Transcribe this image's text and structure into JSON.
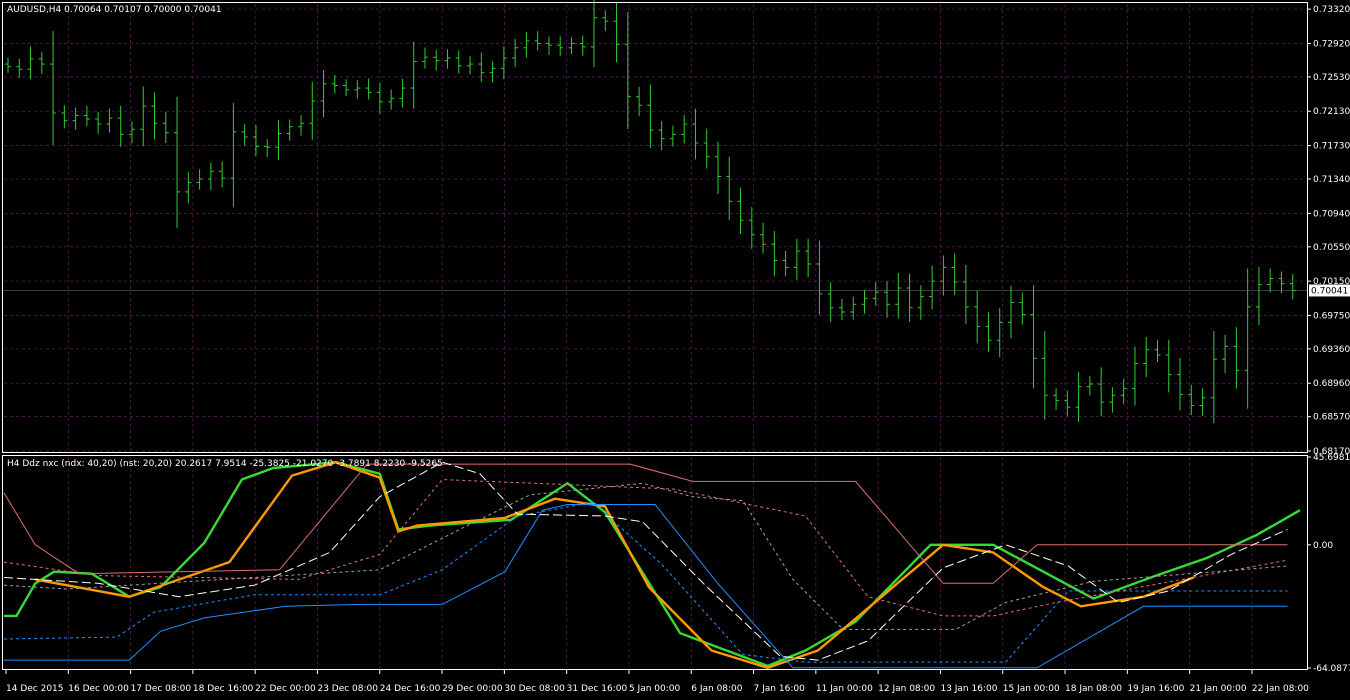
{
  "main_window": {
    "header": "AUDUSD,H4  0.70064 0.70107 0.70000 0.70041",
    "current_price_label": "0.70041"
  },
  "indicator_window": {
    "header": "H4 Ddz nxc (ndx: 40,20) (nst: 20,20) 20.2617 7.9514 -25.3825 -21.0270 -3.7891 8.2230 -9.5265"
  },
  "time_axis_labels": [
    "14 Dec 2015",
    "16 Dec 00:00",
    "17 Dec 08:00",
    "18 Dec 16:00",
    "22 Dec 00:00",
    "23 Dec 08:00",
    "24 Dec 16:00",
    "29 Dec 00:00",
    "30 Dec 08:00",
    "31 Dec 16:00",
    "5 Jan 00:00",
    "6 Jan 08:00",
    "7 Jan 16:00",
    "11 Jan 00:00",
    "12 Jan 08:00",
    "13 Jan 16:00",
    "15 Jan 00:00",
    "18 Jan 08:00",
    "19 Jan 16:00",
    "21 Jan 00:00",
    "22 Jan 08:00"
  ],
  "colors": {
    "background": "#000000",
    "bars": "#33cc33",
    "grid": "#5a1a5a",
    "axis": "#ffffff",
    "green_line": "#33dd33",
    "orange_line": "#ff9900",
    "blue_line": "#1e90ff",
    "salmon_line": "#e07070",
    "white_dash": "#ffffff",
    "gray_dash": "#a0a0a0"
  },
  "chart_data": [
    {
      "type": "ohlc",
      "symbol": "AUDUSD",
      "timeframe": "H4",
      "y_ticks": [
        "0.73320",
        "0.72920",
        "0.72530",
        "0.72130",
        "0.71730",
        "0.71340",
        "0.70940",
        "0.70550",
        "0.70150",
        "0.69750",
        "0.69360",
        "0.68960",
        "0.68570",
        "0.68170"
      ],
      "ylim": [
        0.6817,
        0.7338
      ],
      "current_price": 0.70041,
      "close_path": [
        0.7265,
        0.7262,
        0.7274,
        0.7268,
        0.7211,
        0.7202,
        0.7208,
        0.7204,
        0.7198,
        0.7205,
        0.7186,
        0.7192,
        0.7219,
        0.7199,
        0.7188,
        0.7119,
        0.713,
        0.7134,
        0.7143,
        0.7135,
        0.7189,
        0.7183,
        0.7172,
        0.7171,
        0.7187,
        0.7195,
        0.7199,
        0.7225,
        0.7245,
        0.7243,
        0.7238,
        0.724,
        0.7235,
        0.7224,
        0.7228,
        0.724,
        0.7271,
        0.7276,
        0.7272,
        0.7275,
        0.7266,
        0.7268,
        0.7258,
        0.7263,
        0.7275,
        0.7287,
        0.7295,
        0.7292,
        0.729,
        0.7287,
        0.7292,
        0.7288,
        0.7322,
        0.7318,
        0.7291,
        0.723,
        0.722,
        0.7191,
        0.7181,
        0.7186,
        0.7198,
        0.7176,
        0.716,
        0.7137,
        0.7108,
        0.7086,
        0.7069,
        0.7058,
        0.7039,
        0.7031,
        0.705,
        0.7035,
        0.7,
        0.6984,
        0.6979,
        0.6988,
        0.6995,
        0.7002,
        0.6988,
        0.7007,
        0.6984,
        0.6997,
        0.7015,
        0.7031,
        0.7014,
        0.6985,
        0.6962,
        0.6946,
        0.6967,
        0.699,
        0.6976,
        0.6925,
        0.6882,
        0.6876,
        0.6868,
        0.6892,
        0.6895,
        0.6874,
        0.6882,
        0.689,
        0.6919,
        0.6935,
        0.6929,
        0.6906,
        0.6883,
        0.687,
        0.6879,
        0.6924,
        0.6939,
        0.6911,
        0.6985,
        0.7011,
        0.7018,
        0.7012,
        0.7004
      ]
    },
    {
      "type": "line",
      "indicator": "Ddz nxc",
      "y_ticks": [
        "45.6981",
        "0.00",
        "-64.0877"
      ],
      "ylim": [
        -64.0877,
        45.6981
      ],
      "series": [
        {
          "color": "#33dd33",
          "style": "solid",
          "values": [
            [
              0,
              -37
            ],
            [
              2,
              -37
            ],
            [
              5,
              -20
            ],
            [
              8,
              -14
            ],
            [
              14,
              -15
            ],
            [
              20,
              -27
            ],
            [
              25,
              -22
            ],
            [
              32,
              1
            ],
            [
              38,
              34
            ],
            [
              43,
              40
            ],
            [
              53,
              43
            ],
            [
              60,
              37
            ],
            [
              63,
              8
            ],
            [
              68,
              10
            ],
            [
              81,
              13
            ],
            [
              90,
              32
            ],
            [
              96,
              17
            ],
            [
              108,
              -46
            ],
            [
              122,
              -63
            ],
            [
              128,
              -55
            ],
            [
              136,
              -40
            ],
            [
              148,
              0
            ],
            [
              158,
              0
            ],
            [
              174,
              -28
            ],
            [
              184,
              -16
            ],
            [
              192,
              -7
            ],
            [
              200,
              5
            ],
            [
              207,
              18
            ]
          ]
        },
        {
          "color": "#ff9900",
          "style": "solid",
          "values": [
            [
              5,
              -18
            ],
            [
              20,
              -27
            ],
            [
              36,
              -9
            ],
            [
              46,
              36
            ],
            [
              53,
              43
            ],
            [
              60,
              35
            ],
            [
              63,
              7
            ],
            [
              66,
              10
            ],
            [
              80,
              14
            ],
            [
              88,
              24
            ],
            [
              96,
              20
            ],
            [
              103,
              -22
            ],
            [
              113,
              -55
            ],
            [
              122,
              -64
            ],
            [
              130,
              -55
            ],
            [
              150,
              0
            ],
            [
              158,
              -4
            ],
            [
              166,
              -22
            ],
            [
              172,
              -32
            ],
            [
              182,
              -27
            ],
            [
              190,
              -17
            ]
          ]
        },
        {
          "color": "#1e90ff",
          "style": "solid",
          "values": [
            [
              0,
              -60
            ],
            [
              20,
              -60
            ],
            [
              25,
              -45
            ],
            [
              32,
              -38
            ],
            [
              45,
              -32
            ],
            [
              57,
              -31
            ],
            [
              70,
              -31
            ],
            [
              80,
              -14
            ],
            [
              86,
              18
            ],
            [
              90,
              21
            ],
            [
              104,
              21
            ],
            [
              114,
              -20
            ],
            [
              126,
              -64
            ],
            [
              165,
              -64
            ],
            [
              182,
              -32
            ],
            [
              205,
              -32
            ]
          ]
        },
        {
          "color": "#1e90ff",
          "style": "dashed",
          "values": [
            [
              0,
              -49
            ],
            [
              18,
              -48
            ],
            [
              24,
              -35
            ],
            [
              40,
              -26
            ],
            [
              60,
              -26
            ],
            [
              70,
              -13
            ],
            [
              82,
              15
            ],
            [
              94,
              22
            ],
            [
              105,
              -10
            ],
            [
              118,
              -57
            ],
            [
              128,
              -61
            ],
            [
              160,
              -61
            ],
            [
              170,
              -24
            ],
            [
              205,
              -24
            ]
          ]
        },
        {
          "color": "#e07070",
          "style": "solid",
          "values": [
            [
              0,
              27
            ],
            [
              5,
              0
            ],
            [
              12,
              -15
            ],
            [
              44,
              -13
            ],
            [
              58,
              42
            ],
            [
              100,
              42
            ],
            [
              110,
              33
            ],
            [
              136,
              33
            ],
            [
              150,
              -20
            ],
            [
              158,
              -20
            ],
            [
              165,
              0
            ],
            [
              205,
              0
            ]
          ]
        },
        {
          "color": "#e07070",
          "style": "dashed",
          "values": [
            [
              0,
              -9
            ],
            [
              15,
              -16
            ],
            [
              47,
              -18
            ],
            [
              60,
              -5
            ],
            [
              70,
              34
            ],
            [
              107,
              29
            ],
            [
              128,
              15
            ],
            [
              138,
              -27
            ],
            [
              150,
              -37
            ],
            [
              158,
              -37
            ],
            [
              168,
              -30
            ],
            [
              205,
              -8
            ]
          ]
        },
        {
          "color": "#a0a0a0",
          "style": "dashed",
          "values": [
            [
              0,
              -21
            ],
            [
              10,
              -23
            ],
            [
              60,
              -13
            ],
            [
              74,
              10
            ],
            [
              84,
              26
            ],
            [
              102,
              32
            ],
            [
              110,
              25
            ],
            [
              118,
              23
            ],
            [
              126,
              -18
            ],
            [
              134,
              -44
            ],
            [
              152,
              -44
            ],
            [
              160,
              -30
            ],
            [
              174,
              -19
            ],
            [
              205,
              -11
            ]
          ]
        },
        {
          "color": "#ffffff",
          "style": "dashed",
          "values": [
            [
              0,
              -17
            ],
            [
              15,
              -20
            ],
            [
              28,
              -27
            ],
            [
              40,
              -21
            ],
            [
              52,
              -4
            ],
            [
              60,
              25
            ],
            [
              70,
              43
            ],
            [
              76,
              37
            ],
            [
              82,
              16
            ],
            [
              96,
              15
            ],
            [
              102,
              12
            ],
            [
              112,
              -21
            ],
            [
              124,
              -58
            ],
            [
              130,
              -60
            ],
            [
              138,
              -50
            ],
            [
              150,
              -12
            ],
            [
              160,
              0
            ],
            [
              170,
              -11
            ],
            [
              178,
              -30
            ],
            [
              186,
              -24
            ],
            [
              196,
              -5
            ],
            [
              205,
              8
            ]
          ]
        }
      ]
    }
  ]
}
